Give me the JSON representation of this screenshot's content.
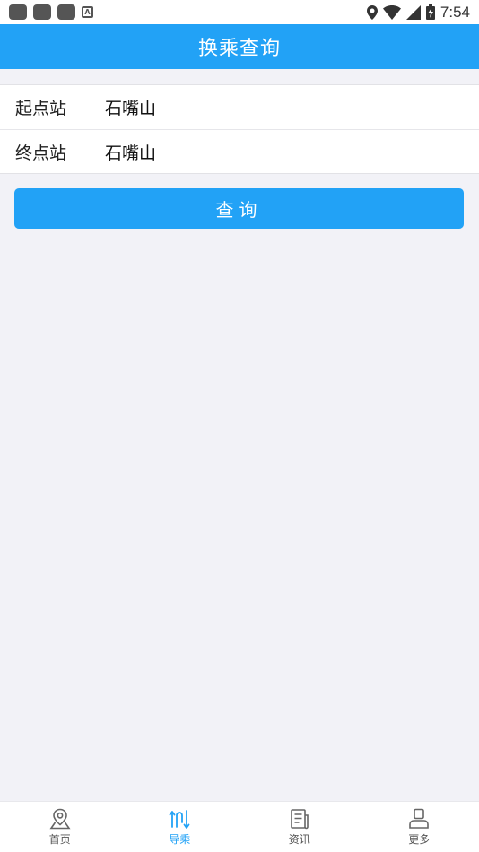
{
  "status_bar": {
    "time": "7:54",
    "notification_letter": "A"
  },
  "header": {
    "title": "换乘查询"
  },
  "form": {
    "start": {
      "label": "起点站",
      "value": "石嘴山"
    },
    "end": {
      "label": "终点站",
      "value": "石嘴山"
    }
  },
  "query_button": {
    "label": "查询"
  },
  "bottom_nav": {
    "items": [
      {
        "label": "首页",
        "icon": "map-pin-icon",
        "active": false
      },
      {
        "label": "导乘",
        "icon": "route-icon",
        "active": true
      },
      {
        "label": "资讯",
        "icon": "news-icon",
        "active": false
      },
      {
        "label": "更多",
        "icon": "person-icon",
        "active": false
      }
    ]
  },
  "colors": {
    "accent": "#22a2f6",
    "background": "#f2f2f7",
    "inactive_icon": "#666666"
  }
}
